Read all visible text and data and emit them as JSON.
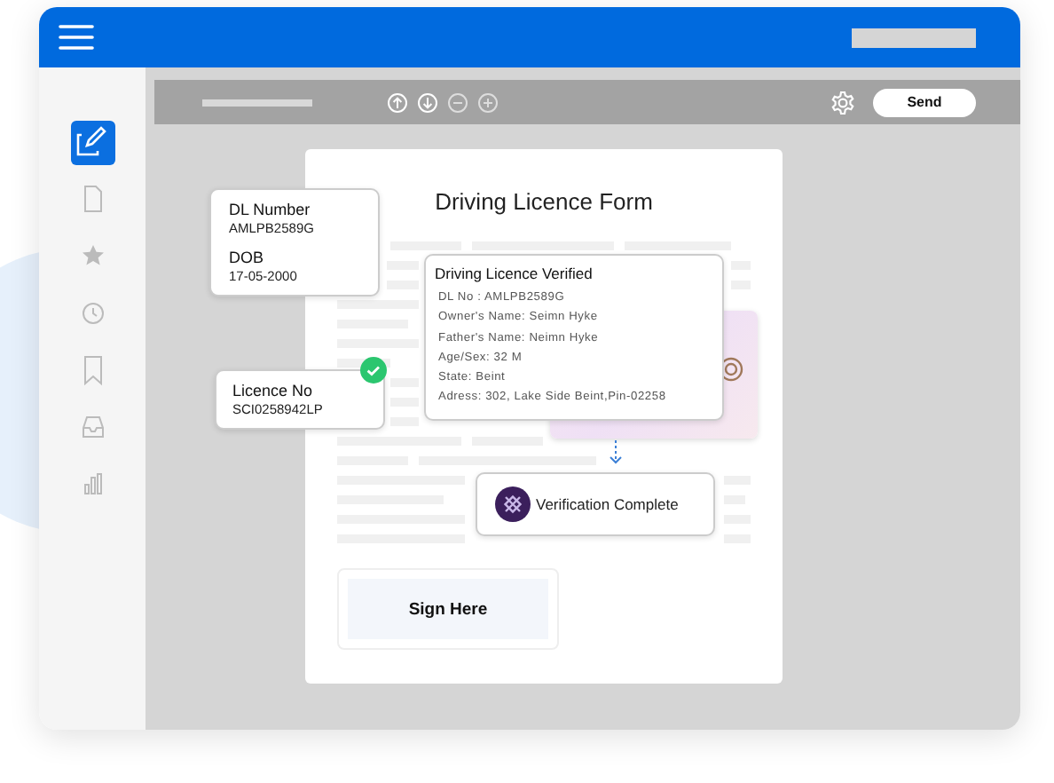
{
  "sidebar": {
    "items": [
      {
        "selected": true
      },
      {
        "selected": false
      },
      {
        "selected": false
      },
      {
        "selected": false
      },
      {
        "selected": false
      },
      {
        "selected": false
      },
      {
        "selected": false
      }
    ]
  },
  "toolbar": {
    "send_button": "Send"
  },
  "document": {
    "title": "Driving Licence Form",
    "sign_box": "Sign Here"
  },
  "dl_card": {
    "fields": [
      {
        "label": "DL Number",
        "value": "AMLPB2589G"
      },
      {
        "label": "DOB",
        "value": "17-05-2000"
      }
    ]
  },
  "licence_card": {
    "label": "Licence No",
    "value": "SCI0258942LP",
    "verified": true
  },
  "verified_card": {
    "title": "Driving Licence Verified",
    "lines": [
      "DL No : AMLPB2589G",
      "Owner's Name: Seimn Hyke",
      "Father's Name: Neimn Hyke",
      "Age/Sex: 32 M",
      "State: Beint",
      "Adress: 302, Lake Side Beint,Pin-02258"
    ]
  },
  "status_card": {
    "text": "Verification Complete"
  }
}
